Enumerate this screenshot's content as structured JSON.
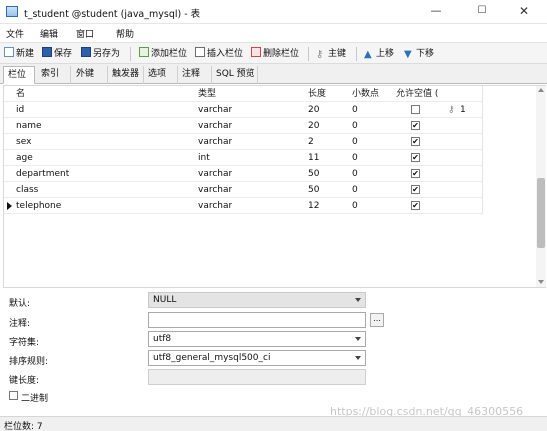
{
  "window": {
    "title": "t_student @student (java_mysql) - 表",
    "min_symbol": "—",
    "max_symbol": "☐",
    "close_symbol": "✕"
  },
  "menu": [
    "文件",
    "编辑",
    "窗口",
    "帮助"
  ],
  "toolbar": {
    "new": "新建",
    "save": "保存",
    "save_as": "另存为",
    "add_field": "添加栏位",
    "insert_field": "插入栏位",
    "delete_field": "删除栏位",
    "primary_key": "主键",
    "move_up": "上移",
    "move_down": "下移"
  },
  "tabs": [
    "栏位",
    "索引",
    "外键",
    "触发器",
    "选项",
    "注释",
    "SQL 预览"
  ],
  "grid": {
    "headers": {
      "name": "名",
      "type": "类型",
      "length": "长度",
      "decimals": "小数点",
      "nullable": "允许空值 (",
      "key": ""
    },
    "rows": [
      {
        "name": "id",
        "type": "varchar",
        "length": "20",
        "decimals": "0",
        "nullable": false,
        "key": "1"
      },
      {
        "name": "name",
        "type": "varchar",
        "length": "20",
        "decimals": "0",
        "nullable": true,
        "key": ""
      },
      {
        "name": "sex",
        "type": "varchar",
        "length": "2",
        "decimals": "0",
        "nullable": true,
        "key": ""
      },
      {
        "name": "age",
        "type": "int",
        "length": "11",
        "decimals": "0",
        "nullable": true,
        "key": ""
      },
      {
        "name": "department",
        "type": "varchar",
        "length": "50",
        "decimals": "0",
        "nullable": true,
        "key": ""
      },
      {
        "name": "class",
        "type": "varchar",
        "length": "50",
        "decimals": "0",
        "nullable": true,
        "key": ""
      },
      {
        "name": "telephone",
        "type": "varchar",
        "length": "12",
        "decimals": "0",
        "nullable": true,
        "key": ""
      }
    ],
    "check_mark": "✔",
    "key_icon": "key-icon"
  },
  "props": {
    "default_label": "默认:",
    "default_value": "NULL",
    "comment_label": "注释:",
    "comment_value": "",
    "ellipsis": "...",
    "charset_label": "字符集:",
    "charset_value": "utf8",
    "collation_label": "排序规则:",
    "collation_value": "utf8_general_mysql500_ci",
    "keylen_label": "键长度:",
    "binary_label": "二进制"
  },
  "status": {
    "field_count": "栏位数: 7"
  },
  "watermark": "https://blog.csdn.net/qq_46300556"
}
